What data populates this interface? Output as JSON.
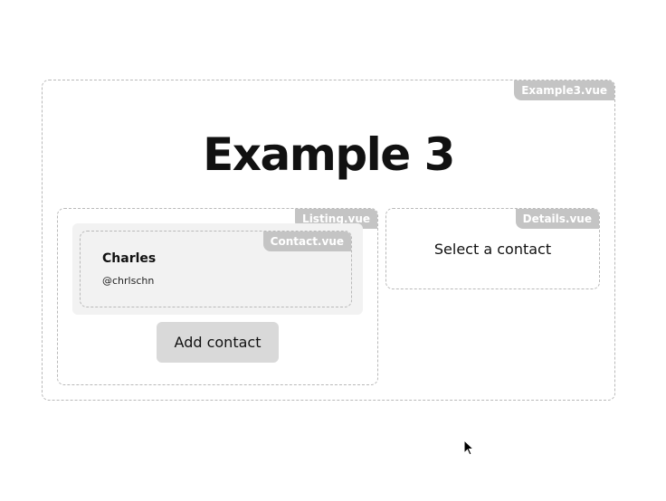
{
  "example": {
    "tag": "Example3.vue",
    "title": "Example 3"
  },
  "listing": {
    "tag": "Listing.vue",
    "contacts": [
      {
        "tag": "Contact.vue",
        "name": "Charles",
        "handle": "@chrlschn"
      }
    ],
    "add_button_label": "Add contact"
  },
  "details": {
    "tag": "Details.vue",
    "placeholder": "Select a contact"
  },
  "colors": {
    "tag_background": "#c4c4c4",
    "card_background": "#f2f2f2",
    "button_background": "#d9d9d9",
    "dashed_border": "#b9b9b9"
  },
  "icons": {
    "cursor": "mouse-pointer-icon"
  }
}
